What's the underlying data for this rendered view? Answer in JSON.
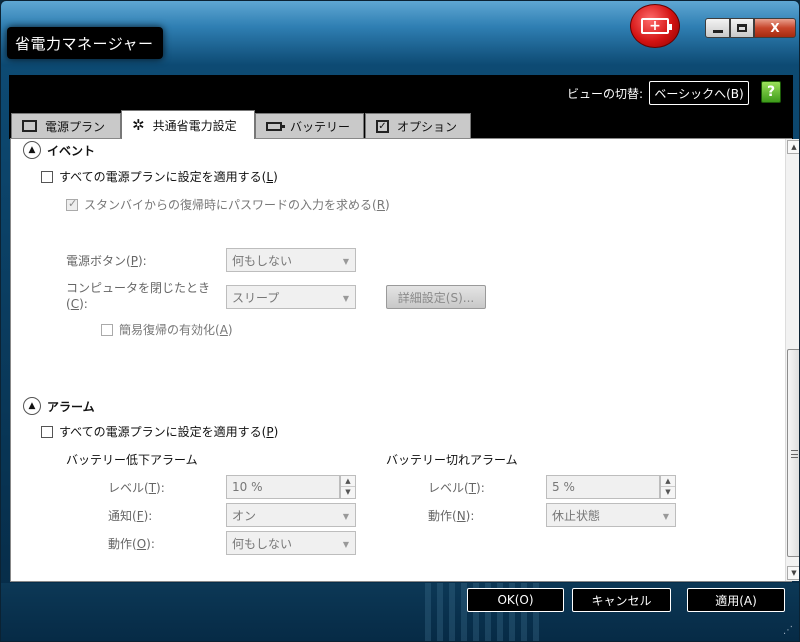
{
  "window": {
    "title": "省電力マネージャー",
    "close_glyph": "X"
  },
  "header": {
    "view_label": "ビューの切替:",
    "view_button": "ベーシックへ(B)",
    "help_glyph": "?"
  },
  "tabs": [
    {
      "label": "電源プラン",
      "icon": "plan-icon"
    },
    {
      "label": "共通省電力設定",
      "icon": "gear-icon",
      "active": true
    },
    {
      "label": "バッテリー",
      "icon": "battery-icon"
    },
    {
      "label": "オプション",
      "icon": "checkbox-icon"
    }
  ],
  "events": {
    "title": "イベント",
    "apply_all_pre": "すべての電源プランに設定を適用する(",
    "apply_all_key": "L",
    "apply_all_post": ")",
    "password_pre": "スタンバイからの復帰時にパスワードの入力を求める(",
    "password_key": "R",
    "password_post": ")",
    "power_button_pre": "電源ボタン(",
    "power_button_key": "P",
    "power_button_post": "):",
    "power_button_value": "何もしない",
    "lid_close_line1": "コンピュータを閉じたとき",
    "lid_close_pre": "(",
    "lid_close_key": "C",
    "lid_close_post": "):",
    "lid_close_value": "スリープ",
    "advanced_button": "詳細設定(S)...",
    "quick_resume_pre": "簡易復帰の有効化(",
    "quick_resume_key": "A",
    "quick_resume_post": ")"
  },
  "alarms": {
    "title": "アラーム",
    "apply_all_pre": "すべての電源プランに設定を適用する(",
    "apply_all_key": "P",
    "apply_all_post": ")",
    "low": {
      "title": "バッテリー低下アラーム",
      "level_pre": "レベル(",
      "level_key": "T",
      "level_post": "):",
      "level_value": "10 %",
      "notify_pre": "通知(",
      "notify_key": "F",
      "notify_post": "):",
      "notify_value": "オン",
      "action_pre": "動作(",
      "action_key": "O",
      "action_post": "):",
      "action_value": "何もしない"
    },
    "critical": {
      "title": "バッテリー切れアラーム",
      "level_pre": "レベル(",
      "level_key": "T",
      "level_post": "):",
      "level_value": "5 %",
      "action_pre": "動作(",
      "action_key": "N",
      "action_post": "):",
      "action_value": "休止状態"
    }
  },
  "buttons": {
    "ok": "OK(O)",
    "cancel": "キャンセル",
    "apply": "適用(A)"
  }
}
